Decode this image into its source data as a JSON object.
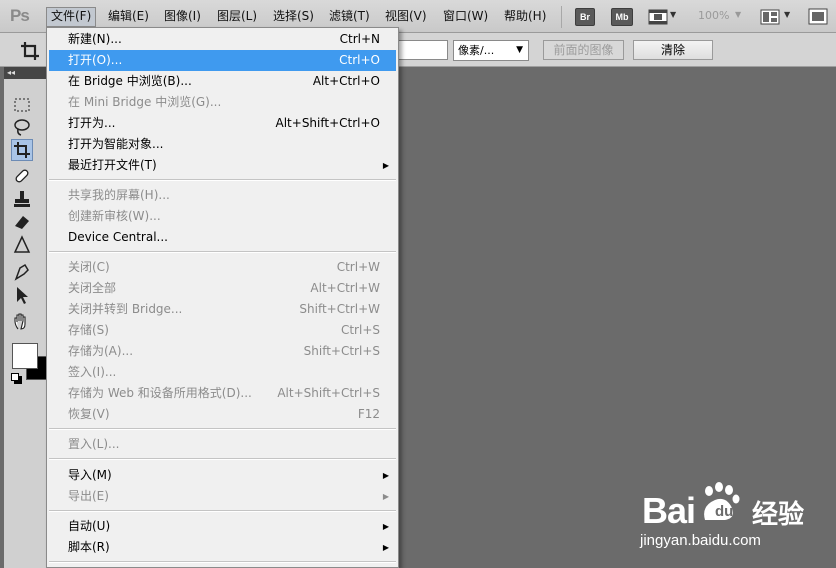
{
  "app": {
    "logo": "Ps"
  },
  "menubar": {
    "items": [
      {
        "label": "文件(F)",
        "active": true
      },
      {
        "label": "编辑(E)"
      },
      {
        "label": "图像(I)"
      },
      {
        "label": "图层(L)"
      },
      {
        "label": "选择(S)"
      },
      {
        "label": "滤镜(T)"
      },
      {
        "label": "视图(V)"
      },
      {
        "label": "窗口(W)"
      },
      {
        "label": "帮助(H)"
      }
    ],
    "icons": {
      "br": "Br",
      "mb": "Mb"
    },
    "zoom": "100%"
  },
  "options_bar": {
    "unit": "像素/...",
    "front_image_label": "前面的图像",
    "clear_label": "清除"
  },
  "file_menu": {
    "items": [
      {
        "label": "新建(N)...",
        "shortcut": "Ctrl+N"
      },
      {
        "label": "打开(O)...",
        "shortcut": "Ctrl+O",
        "highlight": true
      },
      {
        "label": "在 Bridge 中浏览(B)...",
        "shortcut": "Alt+Ctrl+O"
      },
      {
        "label": "在 Mini Bridge 中浏览(G)...",
        "disabled": true
      },
      {
        "label": "打开为...",
        "shortcut": "Alt+Shift+Ctrl+O"
      },
      {
        "label": "打开为智能对象..."
      },
      {
        "label": "最近打开文件(T)",
        "submenu": true
      },
      {
        "label": "共享我的屏幕(H)...",
        "disabled": true
      },
      {
        "label": "创建新审核(W)...",
        "disabled": true
      },
      {
        "label": "Device Central..."
      },
      {
        "label": "关闭(C)",
        "shortcut": "Ctrl+W",
        "disabled": true
      },
      {
        "label": "关闭全部",
        "shortcut": "Alt+Ctrl+W",
        "disabled": true
      },
      {
        "label": "关闭并转到 Bridge...",
        "shortcut": "Shift+Ctrl+W",
        "disabled": true
      },
      {
        "label": "存储(S)",
        "shortcut": "Ctrl+S",
        "disabled": true
      },
      {
        "label": "存储为(A)...",
        "shortcut": "Shift+Ctrl+S",
        "disabled": true
      },
      {
        "label": "签入(I)...",
        "disabled": true
      },
      {
        "label": "存储为 Web 和设备所用格式(D)...",
        "shortcut": "Alt+Shift+Ctrl+S",
        "disabled": true
      },
      {
        "label": "恢复(V)",
        "shortcut": "F12",
        "disabled": true
      },
      {
        "label": "置入(L)...",
        "disabled": true
      },
      {
        "label": "导入(M)",
        "submenu": true
      },
      {
        "label": "导出(E)",
        "submenu": true,
        "disabled": true
      },
      {
        "label": "自动(U)",
        "submenu": true
      },
      {
        "label": "脚本(R)",
        "submenu": true
      }
    ]
  },
  "watermark": {
    "brand": "Bai",
    "brand_cn": "经验",
    "url": "jingyan.baidu.com"
  },
  "colors": {
    "highlight": "#3f9aef",
    "canvas": "#6b6b6b",
    "menubar": "#d0d0d0"
  }
}
